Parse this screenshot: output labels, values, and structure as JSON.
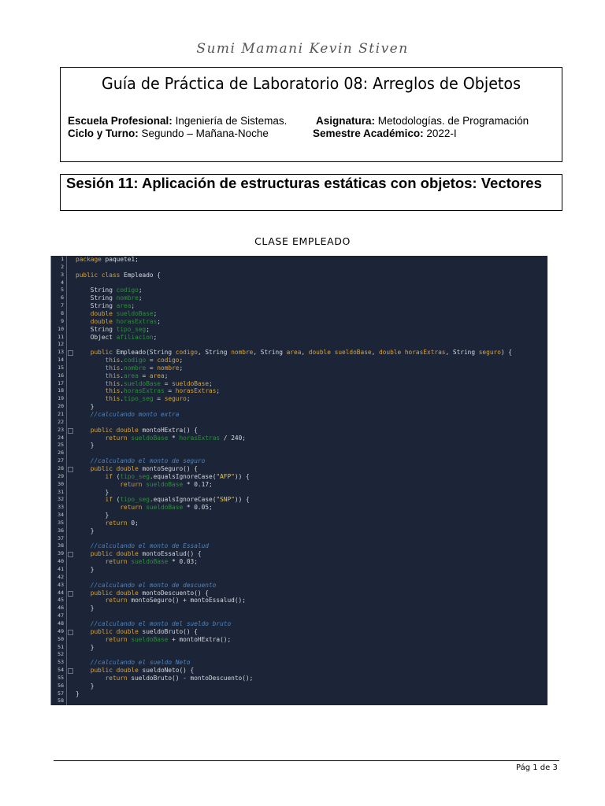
{
  "author": "Sumi Mamani Kevin Stiven",
  "header": {
    "title": "Guía de Práctica de Laboratorio 08: Arreglos de Objetos",
    "escuela_label": "Escuela Profesional:",
    "escuela_value": "Ingeniería de Sistemas.",
    "asignatura_label": "Asignatura:",
    "asignatura_value": "Metodologías. de Programación",
    "ciclo_label": "Ciclo y Turno:",
    "ciclo_value": "Segundo – Mañana-Noche",
    "semestre_label": "Semestre Académico:",
    "semestre_value": "2022-I"
  },
  "session_title": "Sesión 11: Aplicación de estructuras estáticas con objetos: Vectores",
  "section_heading": "CLASE EMPLEADO",
  "colors": {
    "keyword": "#d8a33b",
    "field": "#2f8f3d",
    "comment": "#4e84c4",
    "background": "#1b2537"
  },
  "code": {
    "fold_lines": [
      13,
      23,
      28,
      39,
      44,
      49,
      54
    ],
    "lines": [
      [
        [
          "k",
          "package"
        ],
        [
          "t",
          " paquete1;"
        ]
      ],
      [],
      [
        [
          "k",
          "public class"
        ],
        [
          "t",
          " Empleado {"
        ]
      ],
      [],
      [
        [
          "t",
          "    String "
        ],
        [
          "f",
          "codigo"
        ],
        [
          "t",
          ";"
        ]
      ],
      [
        [
          "t",
          "    String "
        ],
        [
          "f",
          "nombre"
        ],
        [
          "t",
          ";"
        ]
      ],
      [
        [
          "t",
          "    String "
        ],
        [
          "f",
          "area"
        ],
        [
          "t",
          ";"
        ]
      ],
      [
        [
          "k",
          "    double "
        ],
        [
          "f",
          "sueldoBase"
        ],
        [
          "t",
          ";"
        ]
      ],
      [
        [
          "k",
          "    double "
        ],
        [
          "f",
          "horasExtras"
        ],
        [
          "t",
          ";"
        ]
      ],
      [
        [
          "t",
          "    String "
        ],
        [
          "f",
          "tipo_seg"
        ],
        [
          "t",
          ";"
        ]
      ],
      [
        [
          "t",
          "    Object "
        ],
        [
          "f",
          "afiliacion"
        ],
        [
          "t",
          ";"
        ]
      ],
      [],
      [
        [
          "k",
          "    public"
        ],
        [
          "t",
          " Empleado(String "
        ],
        [
          "k",
          "codigo"
        ],
        [
          "t",
          ", String "
        ],
        [
          "k",
          "nombre"
        ],
        [
          "t",
          ", String "
        ],
        [
          "k",
          "area"
        ],
        [
          "t",
          ", "
        ],
        [
          "k",
          "double sueldoBase"
        ],
        [
          "t",
          ", "
        ],
        [
          "k",
          "double horasExtras"
        ],
        [
          "t",
          ", String "
        ],
        [
          "k",
          "seguro"
        ],
        [
          "t",
          ") {"
        ]
      ],
      [
        [
          "k",
          "        this"
        ],
        [
          "t",
          "."
        ],
        [
          "f",
          "codigo"
        ],
        [
          "t",
          " = "
        ],
        [
          "k",
          "codigo"
        ],
        [
          "t",
          ";"
        ]
      ],
      [
        [
          "k",
          "        this"
        ],
        [
          "t",
          "."
        ],
        [
          "f",
          "nombre"
        ],
        [
          "t",
          " = "
        ],
        [
          "k",
          "nombre"
        ],
        [
          "t",
          ";"
        ]
      ],
      [
        [
          "k",
          "        this"
        ],
        [
          "t",
          "."
        ],
        [
          "f",
          "area"
        ],
        [
          "t",
          " = "
        ],
        [
          "k",
          "area"
        ],
        [
          "t",
          ";"
        ]
      ],
      [
        [
          "k",
          "        this"
        ],
        [
          "t",
          "."
        ],
        [
          "f",
          "sueldoBase"
        ],
        [
          "t",
          " = "
        ],
        [
          "k",
          "sueldoBase"
        ],
        [
          "t",
          ";"
        ]
      ],
      [
        [
          "k",
          "        this"
        ],
        [
          "t",
          "."
        ],
        [
          "f",
          "horasExtras"
        ],
        [
          "t",
          " = "
        ],
        [
          "k",
          "horasExtras"
        ],
        [
          "t",
          ";"
        ]
      ],
      [
        [
          "k",
          "        this"
        ],
        [
          "t",
          "."
        ],
        [
          "f",
          "tipo_seg"
        ],
        [
          "t",
          " = "
        ],
        [
          "k",
          "seguro"
        ],
        [
          "t",
          ";"
        ]
      ],
      [
        [
          "t",
          "    }"
        ]
      ],
      [
        [
          "c",
          "    //calculando monto extra"
        ]
      ],
      [],
      [
        [
          "k",
          "    public double"
        ],
        [
          "t",
          " montoHExtra() {"
        ]
      ],
      [
        [
          "k",
          "        return "
        ],
        [
          "f",
          "sueldoBase"
        ],
        [
          "t",
          " * "
        ],
        [
          "f",
          "horasExtras"
        ],
        [
          "t",
          " / 240;"
        ]
      ],
      [
        [
          "t",
          "    }"
        ]
      ],
      [],
      [
        [
          "c",
          "    //calculando el monto de seguro"
        ]
      ],
      [
        [
          "k",
          "    public double"
        ],
        [
          "t",
          " montoSeguro() {"
        ]
      ],
      [
        [
          "k",
          "        if"
        ],
        [
          "t",
          " ("
        ],
        [
          "f",
          "tipo_seg"
        ],
        [
          "t",
          ".equalsIgnoreCase("
        ],
        [
          "s",
          "\"AFP\""
        ],
        [
          "t",
          ")) {"
        ]
      ],
      [
        [
          "k",
          "            return "
        ],
        [
          "f",
          "sueldoBase"
        ],
        [
          "t",
          " * 0.17;"
        ]
      ],
      [
        [
          "t",
          "        }"
        ]
      ],
      [
        [
          "k",
          "        if"
        ],
        [
          "t",
          " ("
        ],
        [
          "f",
          "tipo_seg"
        ],
        [
          "t",
          ".equalsIgnoreCase("
        ],
        [
          "s",
          "\"SNP\""
        ],
        [
          "t",
          ")) {"
        ]
      ],
      [
        [
          "k",
          "            return "
        ],
        [
          "f",
          "sueldoBase"
        ],
        [
          "t",
          " * 0.05;"
        ]
      ],
      [
        [
          "t",
          "        }"
        ]
      ],
      [
        [
          "k",
          "        return"
        ],
        [
          "t",
          " 0;"
        ]
      ],
      [
        [
          "t",
          "    }"
        ]
      ],
      [],
      [
        [
          "c",
          "    //calculando el monto de Essalud"
        ]
      ],
      [
        [
          "k",
          "    public double"
        ],
        [
          "t",
          " montoEssalud() {"
        ]
      ],
      [
        [
          "k",
          "        return "
        ],
        [
          "f",
          "sueldoBase"
        ],
        [
          "t",
          " * 0.03;"
        ]
      ],
      [
        [
          "t",
          "    }"
        ]
      ],
      [],
      [
        [
          "c",
          "    //calculando el monto de descuento"
        ]
      ],
      [
        [
          "k",
          "    public double"
        ],
        [
          "t",
          " montoDescuento() {"
        ]
      ],
      [
        [
          "k",
          "        return"
        ],
        [
          "t",
          " montoSeguro() + montoEssalud();"
        ]
      ],
      [
        [
          "t",
          "    }"
        ]
      ],
      [],
      [
        [
          "c",
          "    //calculando el monto del sueldo bruto"
        ]
      ],
      [
        [
          "k",
          "    public double"
        ],
        [
          "t",
          " sueldoBruto() {"
        ]
      ],
      [
        [
          "k",
          "        return "
        ],
        [
          "f",
          "sueldoBase"
        ],
        [
          "t",
          " + montoHExtra();"
        ]
      ],
      [
        [
          "t",
          "    }"
        ]
      ],
      [],
      [
        [
          "c",
          "    //calculando el sueldo Neto"
        ]
      ],
      [
        [
          "k",
          "    public double"
        ],
        [
          "t",
          " sueldoNeto() {"
        ]
      ],
      [
        [
          "k",
          "        return"
        ],
        [
          "t",
          " sueldoBruto() - montoDescuento();"
        ]
      ],
      [
        [
          "t",
          "    }"
        ]
      ],
      [
        [
          "t",
          "}"
        ]
      ],
      []
    ]
  },
  "footer": {
    "page": "Pág 1 de 3"
  }
}
